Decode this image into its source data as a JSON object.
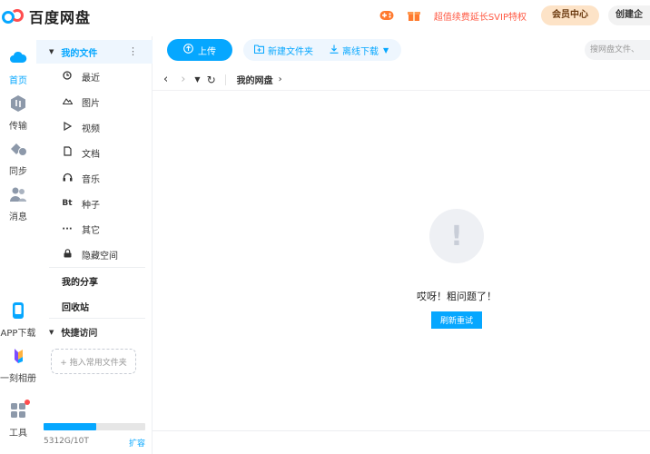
{
  "app": {
    "name": "百度网盘"
  },
  "topbar": {
    "vip_promo": "超值续费延长SVIP特权",
    "member_center": "会员中心",
    "create": "创建企"
  },
  "leftnav": {
    "items": [
      {
        "label": "首页",
        "icon": "cloud-icon",
        "active": true
      },
      {
        "label": "传输",
        "icon": "transfer-icon"
      },
      {
        "label": "同步",
        "icon": "sync-icon"
      },
      {
        "label": "消息",
        "icon": "message-icon"
      },
      {
        "label": "APP下载",
        "icon": "phone-icon"
      },
      {
        "label": "一刻相册",
        "icon": "album-icon"
      },
      {
        "label": "工具",
        "icon": "tools-icon"
      }
    ]
  },
  "sidebar": {
    "my_files": "我的文件",
    "file_types": [
      {
        "label": "最近",
        "icon": "clock-icon"
      },
      {
        "label": "图片",
        "icon": "image-icon"
      },
      {
        "label": "视频",
        "icon": "video-icon"
      },
      {
        "label": "文档",
        "icon": "document-icon"
      },
      {
        "label": "音乐",
        "icon": "music-icon"
      },
      {
        "label": "种子",
        "icon": "bt-icon",
        "glyph": "Bt"
      },
      {
        "label": "其它",
        "icon": "more-icon"
      },
      {
        "label": "隐藏空间",
        "icon": "lock-icon"
      }
    ],
    "my_share": "我的分享",
    "recycle_bin": "回收站",
    "quick_access": "快捷访问",
    "drop_hint": "+ 拖入常用文件夹",
    "quota_text": "5312G/10T",
    "quota_fraction": 0.52,
    "expand": "扩容"
  },
  "toolbar": {
    "upload": "上传",
    "new_folder": "新建文件夹",
    "offline_download": "离线下载",
    "search_placeholder": "搜网盘文件、"
  },
  "breadcrumb": {
    "path": "我的网盘"
  },
  "error": {
    "message": "哎呀！粗问题了！",
    "retry": "刷新重试"
  },
  "colors": {
    "accent": "#06a7ff",
    "promo": "#ff5a44",
    "badge": "#ff4d4f"
  }
}
